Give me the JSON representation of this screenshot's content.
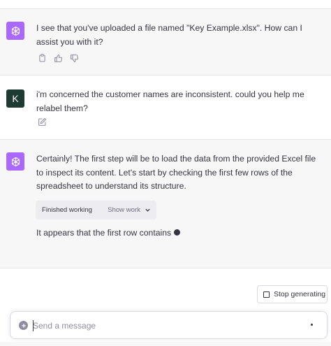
{
  "messages": [
    {
      "role": "assistant",
      "text": "I see that you've uploaded a file named \"Key Example.xlsx\". How can I assist you with it?",
      "actions": [
        "copy-icon",
        "thumbs-up-icon",
        "thumbs-down-icon"
      ]
    },
    {
      "role": "user",
      "avatar_letter": "K",
      "text": "i'm concerned the customer names are inconsistent.  could you help me relabel them?",
      "actions": [
        "edit-icon"
      ]
    },
    {
      "role": "assistant",
      "text": "Certainly! The first step will be to load the data from the provided Excel file to inspect its content. Let's start by checking the first few rows of the spreadsheet to understand its structure.",
      "work_status": "Finished working",
      "show_work_label": "Show work",
      "partial_text": "It appears that the first row contains"
    }
  ],
  "stop_button": {
    "label": "Stop generating",
    "icon": "stop-icon"
  },
  "composer": {
    "placeholder": "Send a message",
    "value": ""
  },
  "colors": {
    "assistant_avatar": "#ab68ff",
    "user_avatar": "#1d3b33",
    "assistant_bg": "#f7f7f8"
  }
}
